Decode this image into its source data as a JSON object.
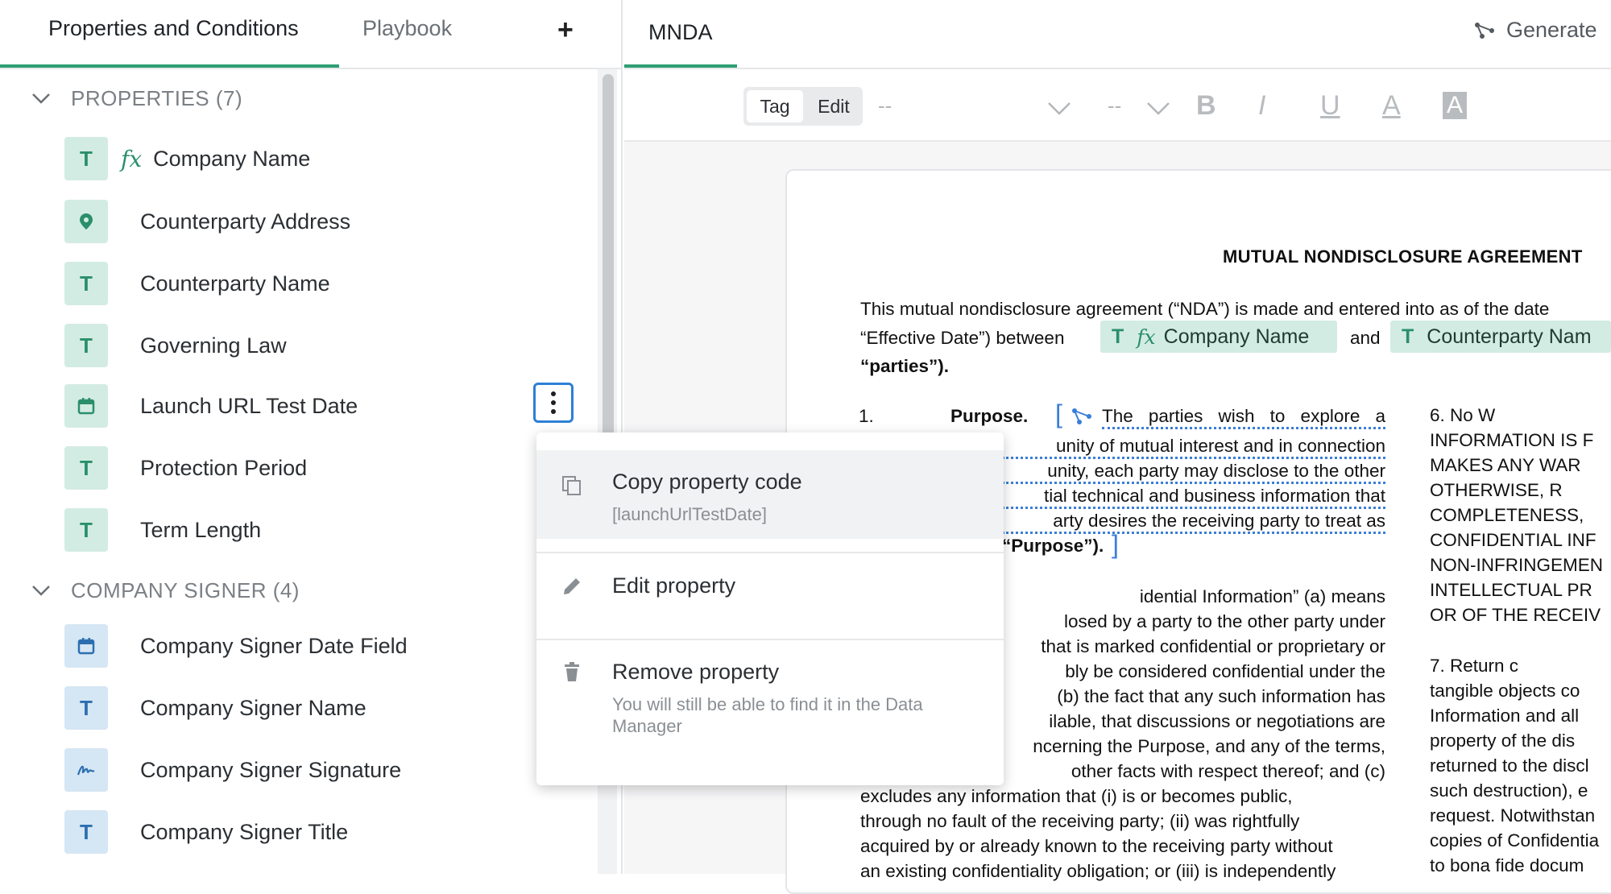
{
  "left_panel": {
    "tabs": [
      {
        "label": "Properties and Conditions"
      },
      {
        "label": "Playbook"
      }
    ],
    "add_label": "+",
    "groups": [
      {
        "title": "PROPERTIES (7)",
        "items": [
          {
            "label": "Company Name",
            "type_icon": "T",
            "formula": "fx"
          },
          {
            "label": "Counterparty Address",
            "type_icon": "location-pin"
          },
          {
            "label": "Counterparty Name",
            "type_icon": "T"
          },
          {
            "label": "Governing Law",
            "type_icon": "T"
          },
          {
            "label": "Launch URL Test Date",
            "type_icon": "calendar"
          },
          {
            "label": "Protection Period",
            "type_icon": "T"
          },
          {
            "label": "Term Length",
            "type_icon": "T"
          }
        ]
      },
      {
        "title": "COMPANY SIGNER (4)",
        "items": [
          {
            "label": "Company Signer Date Field",
            "type_icon": "calendar"
          },
          {
            "label": "Company Signer Name",
            "type_icon": "T"
          },
          {
            "label": "Company Signer Signature",
            "type_icon": "signature"
          },
          {
            "label": "Company Signer Title",
            "type_icon": "T"
          }
        ]
      }
    ]
  },
  "context_menu": {
    "copy": {
      "label": "Copy property code",
      "sub": "[launchUrlTestDate]"
    },
    "edit": {
      "label": "Edit property"
    },
    "remove": {
      "label": "Remove property",
      "sub": "You will still be able to find it in the Data Manager"
    }
  },
  "editor": {
    "tab": "MNDA",
    "generate_label": "Generate",
    "mode": {
      "tag": "Tag",
      "edit": "Edit"
    },
    "font_placeholder": "--",
    "size_placeholder": "--",
    "format_buttons": [
      "B",
      "I",
      "U",
      "A",
      "A"
    ]
  },
  "document": {
    "title": "MUTUAL NONDISCLOSURE AGREEMENT",
    "intro_l1": "This mutual nondisclosure agreement (“NDA”) is made and entered into as of the date",
    "intro_l2_a": "“Effective Date”) between",
    "intro_l2_b": "and",
    "chip1": {
      "type": "T",
      "fx": "fx",
      "label": "Company Name"
    },
    "chip2": {
      "type": "T",
      "label": "Counterparty Nam"
    },
    "intro_l3": "“parties”).",
    "s1_num": "1.",
    "s1_head": "Purpose.",
    "s1_lines": [
      "The parties wish to explore a",
      "unity of mutual interest and in connection",
      "unity, each party may disclose to the other",
      "tial technical and business information that",
      "arty desires the receiving party to treat as",
      "“Purpose”)."
    ],
    "s2_lines": [
      "idential      Information”      (a)      means",
      "losed by a party to the other party under",
      "that is marked confidential or proprietary or",
      "bly be considered confidential under the",
      "(b) the fact that any such information has",
      "ilable, that discussions or negotiations are",
      "ncerning the Purpose, and any of the terms,",
      "other facts with respect thereof; and (c)"
    ],
    "s2_full_lines": [
      "excludes any information that (i) is or becomes public,",
      "through no fault of the receiving party; (ii) was rightfully",
      "acquired by or already known to the receiving party without",
      "an existing confidentiality obligation; or (iii) is independently"
    ],
    "right_col_a": [
      "6.              No     W",
      "INFORMATION IS F",
      "MAKES ANY WAR",
      "OTHERWISE,      R",
      "COMPLETENESS,",
      "CONFIDENTIAL INF",
      "NON-INFRINGEMEN",
      "INTELLECTUAL PR",
      "OR OF THE RECEIV"
    ],
    "right_col_b": [
      "7.              Return  c",
      "tangible objects co",
      "Information and all",
      "property of the dis",
      "returned to the discl",
      "such destruction), e",
      "request. Notwithstan",
      "copies of Confidentia",
      "to bona fide docum"
    ]
  }
}
